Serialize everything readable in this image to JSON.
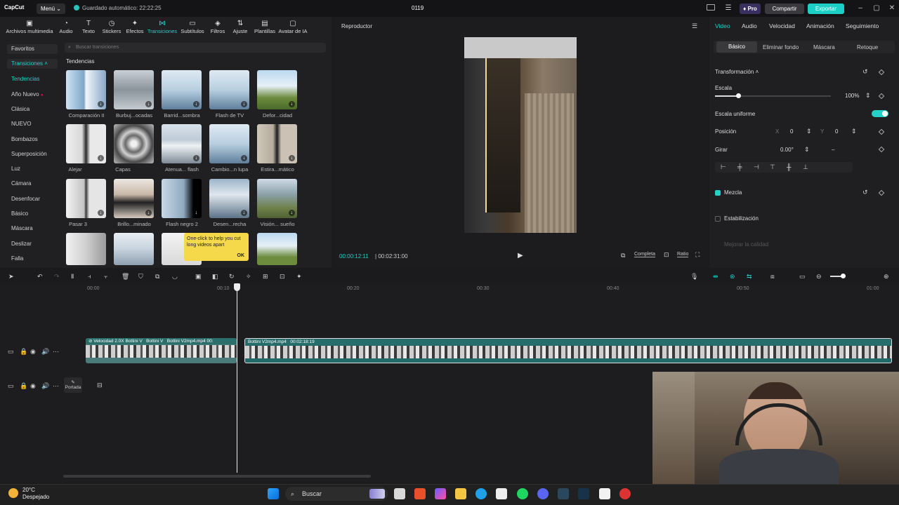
{
  "titlebar": {
    "app_name": "CapCut",
    "menu_label": "Menú",
    "autosave": "Guardado automático: 22:22:25",
    "project_name": "0119",
    "pro_label": "Pro",
    "share_label": "Compartir",
    "export_label": "Exportar"
  },
  "toolbar": [
    {
      "label": "Archivos multimedia",
      "icon": "media-icon"
    },
    {
      "label": "Audio",
      "icon": "audio-icon"
    },
    {
      "label": "Texto",
      "icon": "text-icon"
    },
    {
      "label": "Stickers",
      "icon": "sticker-icon"
    },
    {
      "label": "Efectos",
      "icon": "effects-icon"
    },
    {
      "label": "Transiciones",
      "icon": "transitions-icon"
    },
    {
      "label": "Subtítulos",
      "icon": "subtitles-icon"
    },
    {
      "label": "Filtros",
      "icon": "filters-icon"
    },
    {
      "label": "Ajuste",
      "icon": "adjust-icon"
    },
    {
      "label": "Plantillas",
      "icon": "templates-icon"
    },
    {
      "label": "Avatar de IA",
      "icon": "avatar-icon"
    }
  ],
  "sidebar": {
    "favorites": "Favoritos",
    "transitions": "Transiciones",
    "categories": [
      "Tendencias",
      "Año Nuevo",
      "Clásica",
      "NUEVO",
      "Bombazos",
      "Superposición",
      "Luz",
      "Cámara",
      "Desenfocar",
      "Básico",
      "Máscara",
      "Deslizar",
      "Falla"
    ]
  },
  "search": {
    "placeholder": "Buscar transiciones"
  },
  "section_title": "Tendencias",
  "thumbnails": [
    "Comparación II",
    "Burbuj...ocadas",
    "Barrid...sombra",
    "Flash de TV",
    "Defor...cidad",
    "Alejar",
    "Capas",
    "Atenua... flash",
    "Cambio...n lupa",
    "Estira...mático",
    "Pasar 3",
    "Brillo...minado",
    "Flash negro 2",
    "Desen...recha",
    "Visión... sueño"
  ],
  "tooltip": {
    "text": "One-click to help you cut long videos apart",
    "ok": "OK"
  },
  "player": {
    "title": "Reproductor",
    "current_time": "00:00:12:11",
    "total_time": "00:02:31:00",
    "view_mode": "Completa",
    "ratio": "Ratio"
  },
  "right_panel": {
    "tabs": [
      "Video",
      "Audio",
      "Velocidad",
      "Animación",
      "Seguimiento"
    ],
    "subtabs": [
      "Básico",
      "Eliminar fondo",
      "Máscara",
      "Retoque"
    ],
    "transform": "Transformación",
    "scale_label": "Escala",
    "scale_value": "100%",
    "scale_fraction": 0.2,
    "uniform_label": "Escala uniforme",
    "position_label": "Posición",
    "pos_x_label": "X",
    "pos_x": "0",
    "pos_y_label": "Y",
    "pos_y": "0",
    "rotate_label": "Girar",
    "rotate_value": "0.00°",
    "rotate_extra": "–",
    "blend_label": "Mezcla",
    "stabilize_label": "Estabilización",
    "quality_label": "Mejorar la calidad"
  },
  "timeline": {
    "ruler": [
      "00:00",
      "00:10",
      "00:20",
      "00:30",
      "00:40",
      "00:50",
      "01:00"
    ],
    "clip1_speed": "Velocidad 2.0X",
    "clip1_name": "Bottini V",
    "clip1_name2": "Bottini V",
    "clip1_name3": "Bottini V2mp4.mp4",
    "clip1_time": "00:",
    "clip2_name": "Bottini V2mp4.mp4",
    "clip2_time": "00:02:18:19",
    "cover_label": "Portada"
  },
  "taskbar": {
    "temperature": "20°C",
    "condition": "Despejado",
    "search_label": "Buscar"
  }
}
